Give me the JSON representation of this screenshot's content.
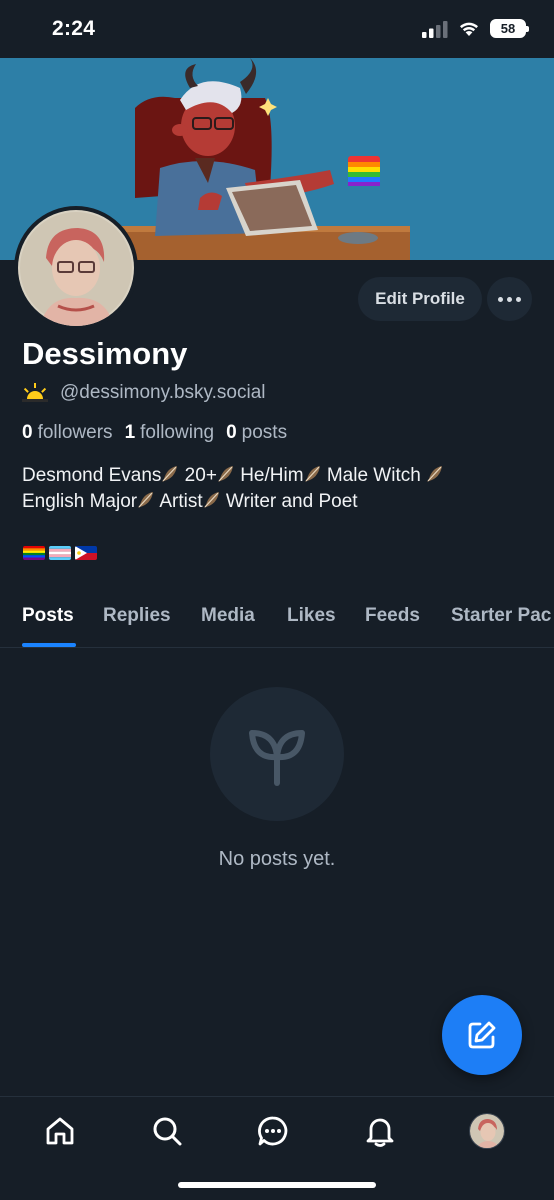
{
  "status_bar": {
    "time": "2:24",
    "battery": "58"
  },
  "profile": {
    "display_name": "Dessimony",
    "handle_icon": "sunrise-emoji",
    "handle": "@dessimony.bsky.social",
    "stats": {
      "followers_count": "0",
      "followers_label": "followers",
      "following_count": "1",
      "following_label": "following",
      "posts_count": "0",
      "posts_label": "posts"
    },
    "bio_segments": [
      "Desmond Evans",
      " 20+",
      " He/Him",
      " Male Witch ",
      "English Major",
      " Artist",
      " Writer and Poet"
    ],
    "bio_icon": "feather-emoji",
    "flags": [
      "rainbow-pride-flag",
      "transgender-flag",
      "philippines-flag"
    ],
    "edit_profile_label": "Edit Profile"
  },
  "tabs": [
    {
      "label": "Posts",
      "active": true
    },
    {
      "label": "Replies",
      "active": false
    },
    {
      "label": "Media",
      "active": false
    },
    {
      "label": "Likes",
      "active": false
    },
    {
      "label": "Feeds",
      "active": false
    },
    {
      "label": "Starter Pac",
      "active": false
    }
  ],
  "empty_state": {
    "icon": "sprout-icon",
    "message": "No posts yet."
  },
  "compose": {
    "icon": "compose-icon"
  },
  "bottom_nav": [
    {
      "name": "home",
      "icon": "home-icon"
    },
    {
      "name": "search",
      "icon": "search-icon"
    },
    {
      "name": "chat",
      "icon": "chat-icon"
    },
    {
      "name": "notifications",
      "icon": "bell-icon"
    },
    {
      "name": "profile",
      "icon": "avatar"
    }
  ],
  "colors": {
    "background": "#161e27",
    "surface": "#1e2935",
    "accent": "#1d7ef6",
    "banner": "#2d7fa7",
    "muted_text": "#aeb8c4"
  }
}
